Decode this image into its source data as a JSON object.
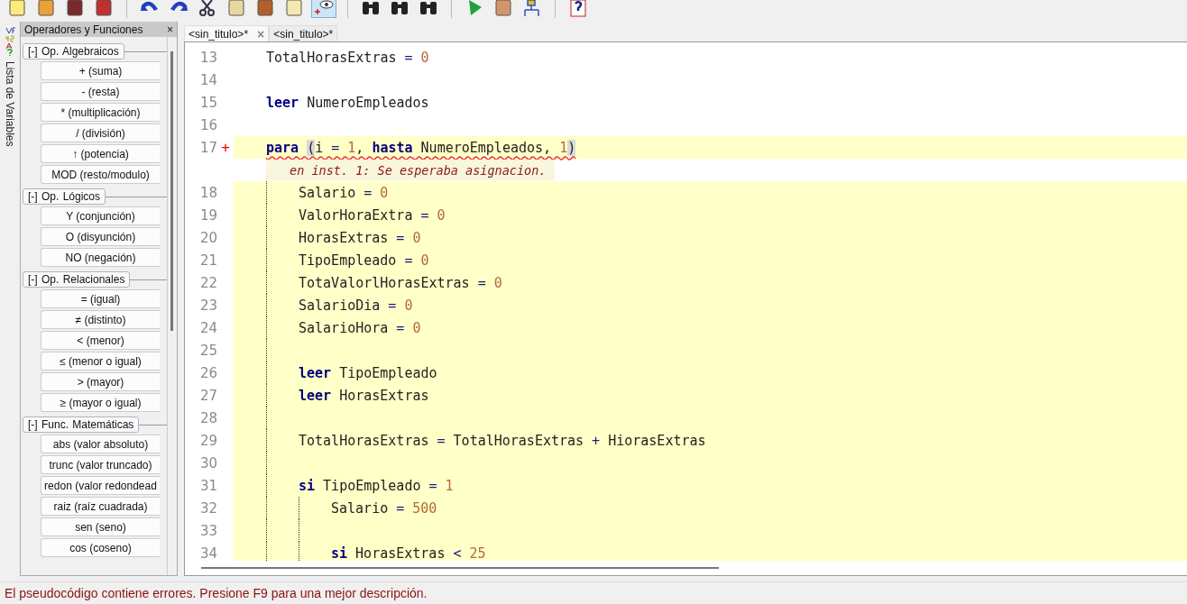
{
  "side_strip": {
    "label": "Lista de Variables"
  },
  "panel": {
    "title": "Operadores y Funciones",
    "close": "×",
    "groups": [
      {
        "toggle": "[-]",
        "title": "Op. Algebraicos",
        "items": [
          "+ (suma)",
          "- (resta)",
          "* (multiplicación)",
          "/ (división)",
          "↑ (potencia)",
          "MOD (resto/modulo)"
        ]
      },
      {
        "toggle": "[-]",
        "title": "Op. Lógicos",
        "items": [
          "Y (conjunción)",
          "O (disyunción)",
          "NO (negación)"
        ]
      },
      {
        "toggle": "[-]",
        "title": "Op. Relacionales",
        "items": [
          "= (igual)",
          "≠ (distinto)",
          "< (menor)",
          "≤ (menor o igual)",
          "> (mayor)",
          "≥ (mayor o igual)"
        ]
      },
      {
        "toggle": "[-]",
        "title": "Func. Matemáticas",
        "items": [
          "abs (valor absoluto)",
          "trunc (valor truncado)",
          "redon (valor redondead",
          "raiz (raíz cuadrada)",
          "sen (seno)",
          "cos (coseno)"
        ]
      }
    ]
  },
  "tabs": [
    {
      "label": "<sin_titulo>*",
      "close": "×",
      "selected": true
    },
    {
      "label": "<sin_titulo>*",
      "selected": false
    }
  ],
  "code": [
    {
      "number": "13",
      "tokens": [
        {
          "kind": "text",
          "text": "TotalHorasExtras"
        },
        {
          "kind": "op",
          "text": " = "
        },
        {
          "kind": "number",
          "text": "0"
        }
      ]
    },
    {
      "number": "14"
    },
    {
      "number": "15",
      "tokens": [
        {
          "kind": "keyword",
          "text": "leer"
        },
        {
          "kind": "text",
          "text": " NumeroEmpleados"
        }
      ]
    },
    {
      "number": "16"
    },
    {
      "number": "17",
      "marker": "+",
      "error": true,
      "current_block": true,
      "annotation": "en inst. 1: Se esperaba asignacion.",
      "tokens": [
        {
          "kind": "keyword",
          "text": "para "
        },
        {
          "kind": "bracket",
          "text": "("
        },
        {
          "kind": "text",
          "text": "i"
        },
        {
          "kind": "op",
          "text": " = "
        },
        {
          "kind": "number",
          "text": "1"
        },
        {
          "kind": "text",
          "text": ", "
        },
        {
          "kind": "keyword",
          "text": "hasta"
        },
        {
          "kind": "text",
          "text": " NumeroEmpleados, "
        },
        {
          "kind": "number",
          "text": "1"
        },
        {
          "kind": "bracket",
          "text": ")"
        }
      ],
      "children": [
        {
          "number": "18",
          "tokens": [
            {
              "kind": "text",
              "text": "Salario"
            },
            {
              "kind": "op",
              "text": " = "
            },
            {
              "kind": "number",
              "text": "0"
            }
          ]
        },
        {
          "number": "19",
          "tokens": [
            {
              "kind": "text",
              "text": "ValorHoraExtra"
            },
            {
              "kind": "op",
              "text": " = "
            },
            {
              "kind": "number",
              "text": "0"
            }
          ]
        },
        {
          "number": "20",
          "tokens": [
            {
              "kind": "text",
              "text": "HorasExtras"
            },
            {
              "kind": "op",
              "text": " = "
            },
            {
              "kind": "number",
              "text": "0"
            }
          ]
        },
        {
          "number": "21",
          "tokens": [
            {
              "kind": "text",
              "text": "TipoEmpleado"
            },
            {
              "kind": "op",
              "text": " = "
            },
            {
              "kind": "number",
              "text": "0"
            }
          ]
        },
        {
          "number": "22",
          "tokens": [
            {
              "kind": "text",
              "text": "TotaValorlHorasExtras"
            },
            {
              "kind": "op",
              "text": " = "
            },
            {
              "kind": "number",
              "text": "0"
            }
          ]
        },
        {
          "number": "23",
          "tokens": [
            {
              "kind": "text",
              "text": "SalarioDia"
            },
            {
              "kind": "op",
              "text": " = "
            },
            {
              "kind": "number",
              "text": "0"
            }
          ]
        },
        {
          "number": "24",
          "tokens": [
            {
              "kind": "text",
              "text": "SalarioHora"
            },
            {
              "kind": "op",
              "text": " = "
            },
            {
              "kind": "number",
              "text": "0"
            }
          ]
        },
        {
          "number": "25"
        },
        {
          "number": "26",
          "tokens": [
            {
              "kind": "keyword",
              "text": "leer"
            },
            {
              "kind": "text",
              "text": " TipoEmpleado"
            }
          ]
        },
        {
          "number": "27",
          "tokens": [
            {
              "kind": "keyword",
              "text": "leer"
            },
            {
              "kind": "text",
              "text": " HorasExtras"
            }
          ]
        },
        {
          "number": "28"
        },
        {
          "number": "29",
          "tokens": [
            {
              "kind": "text",
              "text": "TotalHorasExtras"
            },
            {
              "kind": "op",
              "text": " = "
            },
            {
              "kind": "text",
              "text": "TotalHorasExtras"
            },
            {
              "kind": "op",
              "text": " + "
            },
            {
              "kind": "text",
              "text": "HiorasExtras"
            }
          ]
        },
        {
          "number": "30"
        },
        {
          "number": "31",
          "tokens": [
            {
              "kind": "keyword",
              "text": "si"
            },
            {
              "kind": "text",
              "text": " TipoEmpleado"
            },
            {
              "kind": "op",
              "text": " = "
            },
            {
              "kind": "number",
              "text": "1"
            }
          ],
          "children": [
            {
              "number": "32",
              "tokens": [
                {
                  "kind": "text",
                  "text": "Salario"
                },
                {
                  "kind": "op",
                  "text": " = "
                },
                {
                  "kind": "number",
                  "text": "500"
                }
              ]
            },
            {
              "number": "33"
            },
            {
              "number": "34",
              "tokens": [
                {
                  "kind": "keyword",
                  "text": "si"
                },
                {
                  "kind": "text",
                  "text": " HorasExtras"
                },
                {
                  "kind": "op",
                  "text": " < "
                },
                {
                  "kind": "number",
                  "text": "25"
                }
              ]
            }
          ]
        }
      ]
    }
  ],
  "status_bar": {
    "message": "El pseudocódigo contiene errores. Presione F9 para una mejor descripción."
  }
}
